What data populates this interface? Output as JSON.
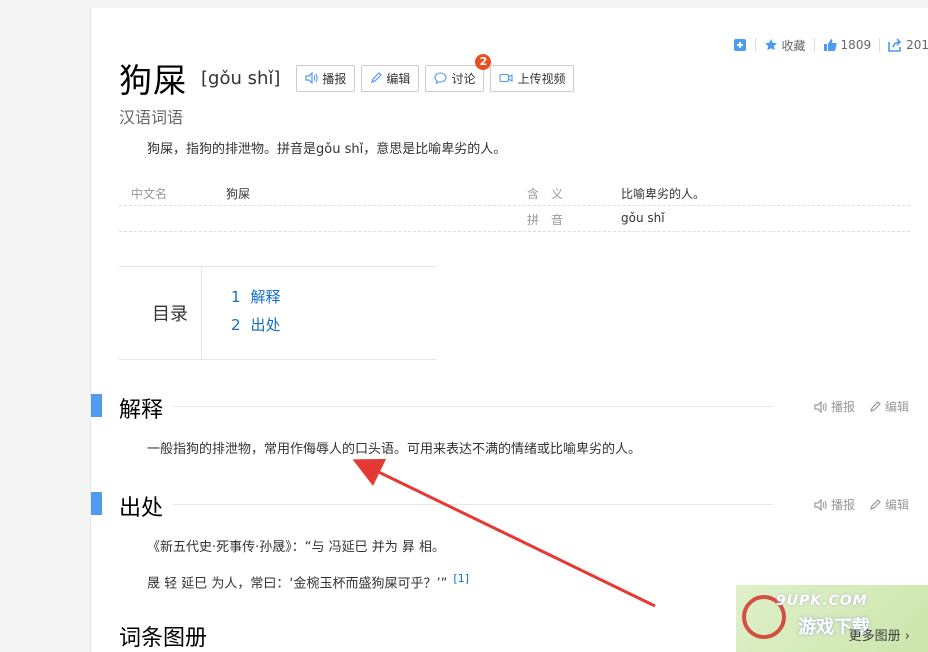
{
  "topbar": {
    "favorite_label": "收藏",
    "like_count": "1809",
    "share_count": "201"
  },
  "entry": {
    "title": "狗屎",
    "pinyin": "[gǒu shǐ]",
    "subtitle": "汉语词语",
    "summary": "狗屎，指狗的排泄物。拼音是gǒu shǐ，意思是比喻卑劣的人。"
  },
  "buttons": {
    "play": "播报",
    "edit": "编辑",
    "discuss": "讨论",
    "discuss_badge": "2",
    "upload_video": "上传视频"
  },
  "basic_info": {
    "row1": {
      "k1": "中文名",
      "v1": "狗屎",
      "k2": "含　义",
      "v2": "比喻卑劣的人。"
    },
    "row2": {
      "k2": "拼　音",
      "v2": "gǒu shǐ"
    }
  },
  "toc": {
    "label": "目录",
    "items": [
      {
        "num": "1",
        "label": "解释"
      },
      {
        "num": "2",
        "label": "出处"
      }
    ]
  },
  "sections": [
    {
      "title": "解释",
      "play": "播报",
      "edit": "编辑",
      "text": "一般指狗的排泄物，常用作侮辱人的口头语。可用来表达不满的情绪或比喻卑劣的人。"
    },
    {
      "title": "出处",
      "play": "播报",
      "edit": "编辑",
      "line1": "《新五代史·死事传·孙晟》：“与 冯延巳 并为 昪 相。",
      "line2": "晟 轻 延巳 为人，常曰：‘金椀玉杯而盛狗屎可乎？’”",
      "ref": "[1]"
    }
  ],
  "album": {
    "title": "词条图册",
    "more": "更多图册"
  },
  "watermark": {
    "text": "9UPK.COM",
    "cn": "游戏下载"
  },
  "colors": {
    "accent": "#4f9cee",
    "link": "#136ec2",
    "badge": "#e8501f",
    "arrow": "#e53935"
  }
}
